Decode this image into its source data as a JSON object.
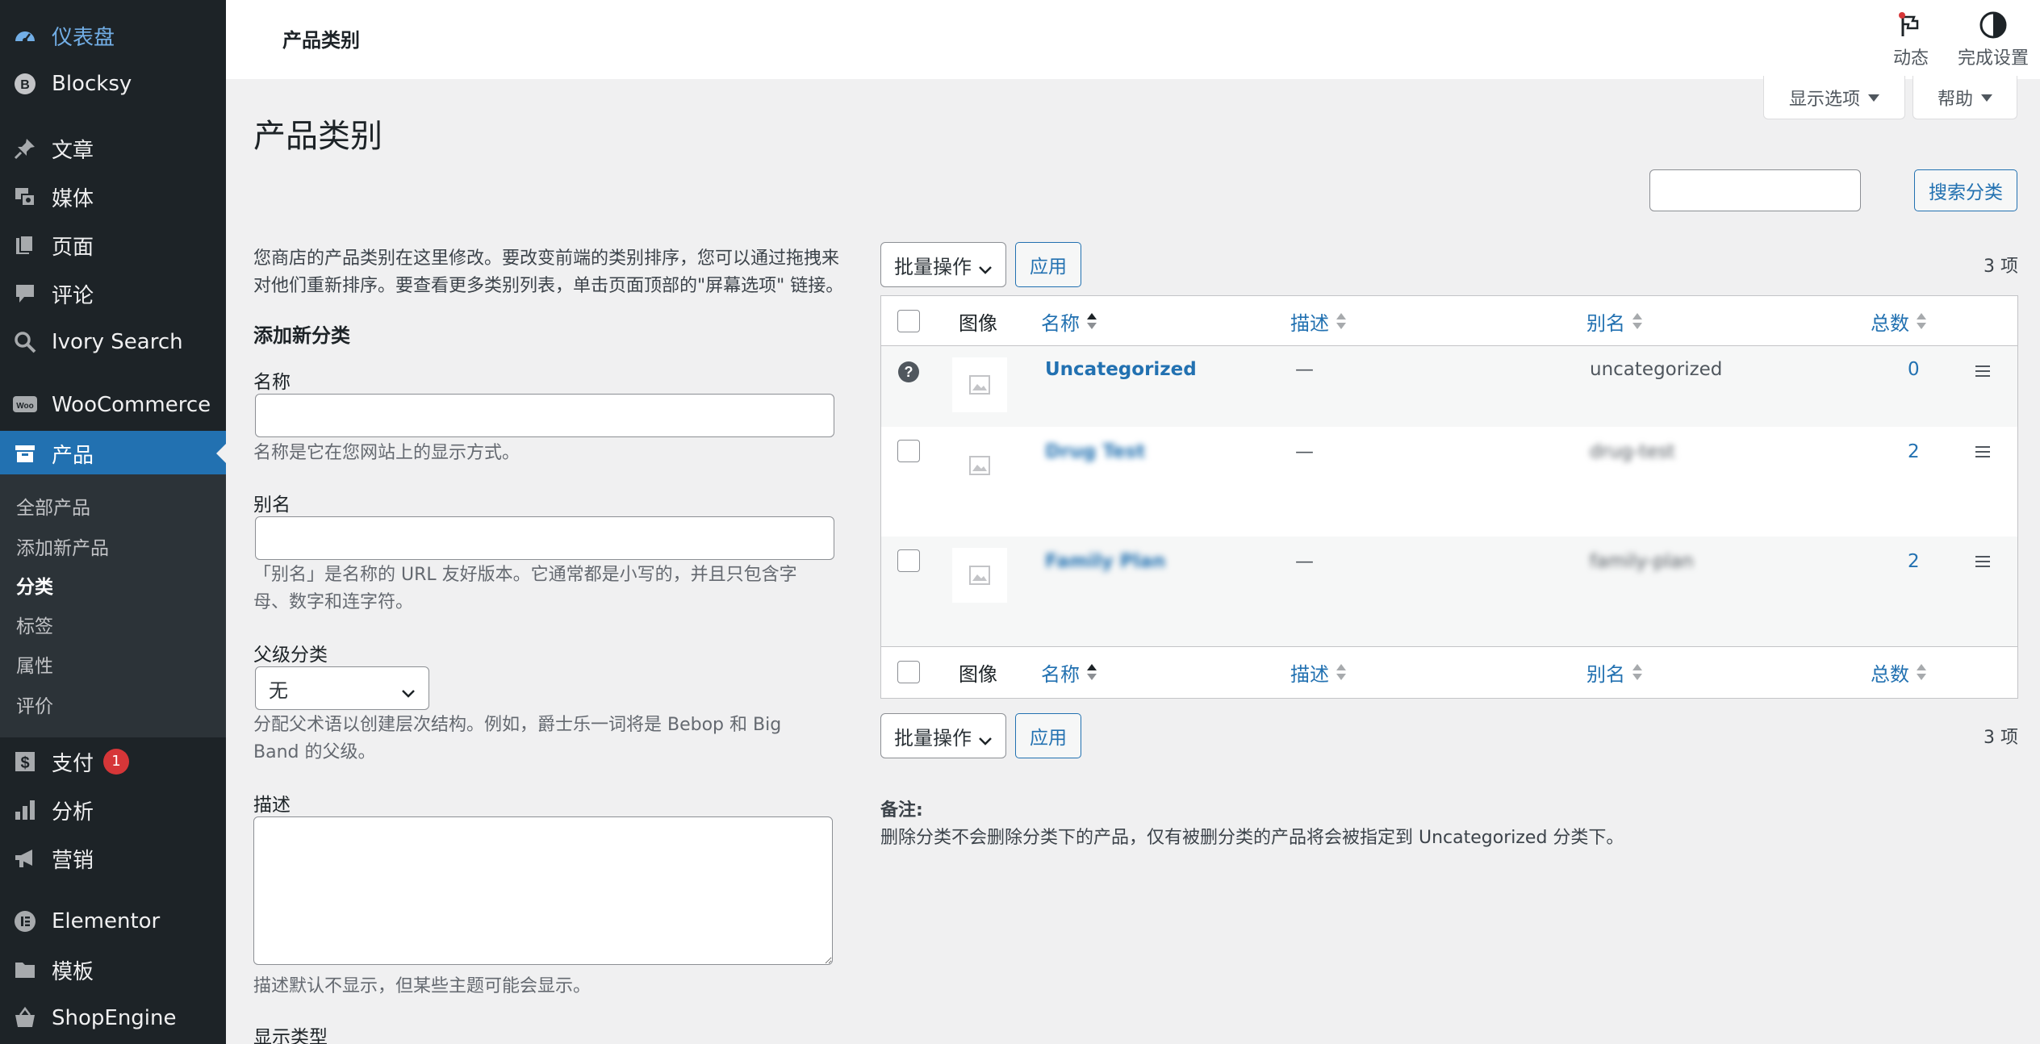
{
  "sidebar": {
    "top": [
      {
        "label": "仪表盘",
        "icon": "dashboard-icon"
      },
      {
        "label": "Blocksy",
        "icon": "blocksy-icon"
      }
    ],
    "group2": [
      {
        "label": "文章",
        "icon": "pin-icon"
      },
      {
        "label": "媒体",
        "icon": "media-icon"
      },
      {
        "label": "页面",
        "icon": "page-icon"
      },
      {
        "label": "评论",
        "icon": "comment-icon"
      },
      {
        "label": "Ivory Search",
        "icon": "search-icon"
      }
    ],
    "woocommerce": {
      "label": "WooCommerce",
      "icon": "woo-icon"
    },
    "products": {
      "label": "产品",
      "icon": "archive-icon"
    },
    "submenu": [
      "全部产品",
      "添加新产品",
      "分类",
      "标签",
      "属性",
      "评价"
    ],
    "group3": [
      {
        "label": "支付",
        "icon": "dollar-icon",
        "badge": "1"
      },
      {
        "label": "分析",
        "icon": "chart-icon"
      },
      {
        "label": "营销",
        "icon": "megaphone-icon"
      }
    ],
    "group4": [
      {
        "label": "Elementor",
        "icon": "elementor-icon"
      },
      {
        "label": "模板",
        "icon": "folder-icon"
      },
      {
        "label": "ShopEngine",
        "icon": "basket-icon"
      }
    ]
  },
  "header": {
    "title": "产品类别",
    "activity_label": "动态",
    "setup_label": "完成设置"
  },
  "screen_options": "显示选项",
  "help": "帮助",
  "page_title": "产品类别",
  "search": {
    "button": "搜索分类",
    "value": ""
  },
  "intro": [
    "您商店的产品类别在这里修改。要改变前端的类别排序，您可以通过拖拽来",
    "对他们重新排序。要查看更多类别列表，单击页面顶部的\"屏幕选项\" 链接。"
  ],
  "form": {
    "heading": "添加新分类",
    "name_label": "名称",
    "name_help": "名称是它在您网站上的显示方式。",
    "slug_label": "别名",
    "slug_help": [
      "「别名」是名称的 URL 友好版本。它通常都是小写的，并且只包含字",
      "母、数字和连字符。"
    ],
    "parent_label": "父级分类",
    "parent_value": "无",
    "parent_help": [
      "分配父术语以创建层次结构。例如，爵士乐一词将是 Bebop 和 Big",
      "Band 的父级。"
    ],
    "desc_label": "描述",
    "desc_help": "描述默认不显示，但某些主题可能会显示。",
    "display_type_label": "显示类型"
  },
  "bulk": {
    "label": "批量操作",
    "apply": "应用",
    "count": "3 项"
  },
  "table": {
    "headers": {
      "image": "图像",
      "name": "名称",
      "description": "描述",
      "slug": "别名",
      "count": "总数"
    },
    "rows": [
      {
        "name": "Uncategorized",
        "description": "—",
        "slug": "uncategorized",
        "count": "0",
        "blurred": false
      },
      {
        "name": "Drug Test",
        "description": "—",
        "slug": "drug-test",
        "count": "2",
        "blurred": true
      },
      {
        "name": "Family Plan",
        "description": "—",
        "slug": "family-plan",
        "count": "2",
        "blurred": true
      }
    ]
  },
  "note": {
    "heading": "备注:",
    "text": "删除分类不会删除分类下的产品，仅有被删分类的产品将会被指定到 Uncategorized 分类下。"
  },
  "colors": {
    "sidebar": "#1d2327",
    "accent": "#2271b1",
    "badge": "#d63638"
  }
}
